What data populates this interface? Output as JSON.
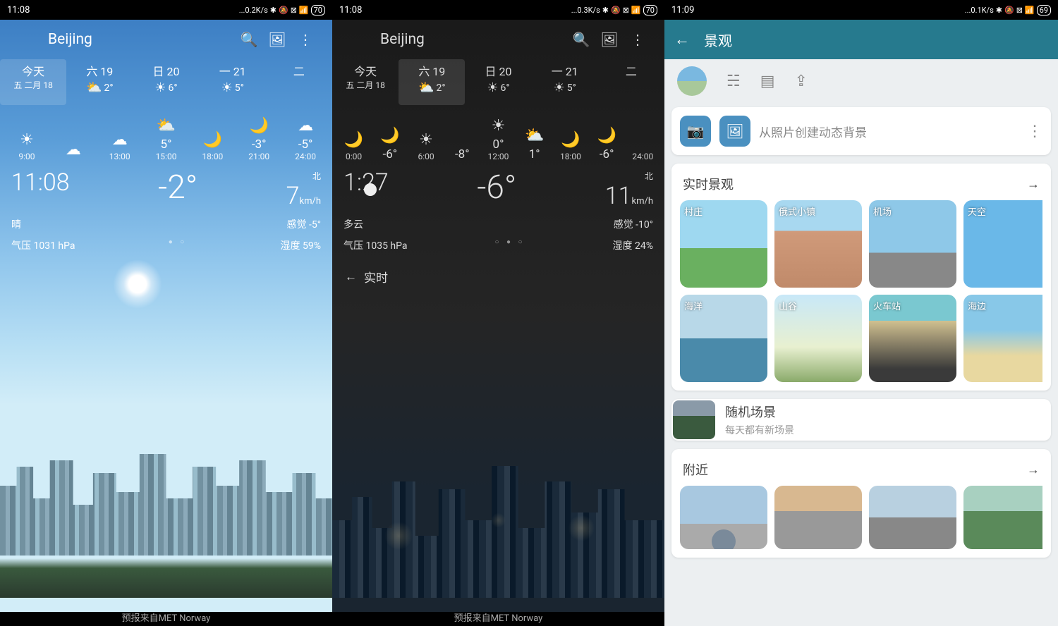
{
  "p1": {
    "status": {
      "time": "11:08",
      "net": "...0.2K/s",
      "batt": "70"
    },
    "location": "Beijing",
    "days": [
      {
        "label": "今天",
        "sub": "五 二月 18",
        "temp": "",
        "sel": true
      },
      {
        "label": "六 19",
        "sub": "",
        "temp": "2°",
        "ico": "pc"
      },
      {
        "label": "日 20",
        "sub": "",
        "temp": "6°",
        "ico": "sun"
      },
      {
        "label": "一 21",
        "sub": "",
        "temp": "5°",
        "ico": "sun"
      },
      {
        "label": "二",
        "sub": "",
        "temp": "",
        "ico": ""
      }
    ],
    "hours": [
      {
        "t": "9:00",
        "temp": "",
        "ico": "sun"
      },
      {
        "t": "",
        "temp": "",
        "ico": "cloud",
        "mark": "○"
      },
      {
        "t": "13:00",
        "temp": "",
        "ico": "cloud"
      },
      {
        "t": "15:00",
        "temp": "5°",
        "ico": "pc"
      },
      {
        "t": "18:00",
        "temp": "",
        "ico": "moon"
      },
      {
        "t": "21:00",
        "temp": "-3°",
        "ico": "moon"
      },
      {
        "t": "24:00",
        "temp": "-5°",
        "ico": "cloud"
      }
    ],
    "now": {
      "time": "11:08",
      "temp": "-2°",
      "wind_v": "7",
      "wind_u": "km/h",
      "wind_d": "北",
      "cond": "晴",
      "feels": "感觉 -5°",
      "press": "气压 1031 hPa",
      "hum": "湿度 59%"
    },
    "footer": "预报来自MET Norway"
  },
  "p2": {
    "status": {
      "time": "11:08",
      "net": "...0.3K/s",
      "batt": "70"
    },
    "location": "Beijing",
    "days": [
      {
        "label": "今天",
        "sub": "五 二月 18",
        "temp": ""
      },
      {
        "label": "六 19",
        "sub": "",
        "temp": "2°",
        "ico": "pc",
        "sel": true
      },
      {
        "label": "日 20",
        "sub": "",
        "temp": "6°",
        "ico": "sun"
      },
      {
        "label": "一 21",
        "sub": "",
        "temp": "5°",
        "ico": "sun"
      },
      {
        "label": "二",
        "sub": "",
        "temp": ""
      }
    ],
    "hours": [
      {
        "t": "0:00",
        "temp": "",
        "ico": "moon"
      },
      {
        "t": "",
        "temp": "-6°",
        "ico": "moon"
      },
      {
        "t": "6:00",
        "temp": "",
        "ico": "sun"
      },
      {
        "t": "",
        "temp": "-8°",
        "ico": ""
      },
      {
        "t": "12:00",
        "temp": "0°",
        "ico": "sun"
      },
      {
        "t": "",
        "temp": "1°",
        "ico": "pc"
      },
      {
        "t": "18:00",
        "temp": "",
        "ico": "moon"
      },
      {
        "t": "",
        "temp": "-6°",
        "ico": "moon"
      },
      {
        "t": "24:00",
        "temp": "",
        "ico": ""
      }
    ],
    "now": {
      "time": "1:27",
      "temp": "-6°",
      "wind_v": "11",
      "wind_u": "km/h",
      "wind_d": "北",
      "cond": "多云",
      "feels": "感觉 -10°",
      "press": "气压 1035 hPa",
      "hum": "湿度 24%"
    },
    "back": "实时",
    "footer": "预报来自MET Norway"
  },
  "p3": {
    "status": {
      "time": "11:09",
      "net": "...0.1K/s",
      "batt": "69"
    },
    "title": "景观",
    "create": "从照片创建动态背景",
    "sec_live": "实时景观",
    "tiles_live": [
      {
        "l": "村庄",
        "c": "t-village"
      },
      {
        "l": "俄式小镇",
        "c": "t-town"
      },
      {
        "l": "机场",
        "c": "t-airport"
      },
      {
        "l": "天空",
        "c": "t-sky"
      },
      {
        "l": "海洋",
        "c": "t-ocean"
      },
      {
        "l": "山谷",
        "c": "t-valley"
      },
      {
        "l": "火车站",
        "c": "t-train"
      },
      {
        "l": "海边",
        "c": "t-beach"
      }
    ],
    "random": {
      "t": "随机场景",
      "s": "每天都有新场景"
    },
    "sec_near": "附近",
    "tiles_near": [
      {
        "c": "t-n1"
      },
      {
        "c": "t-n2"
      },
      {
        "c": "t-n3"
      },
      {
        "c": "t-n4"
      }
    ]
  }
}
